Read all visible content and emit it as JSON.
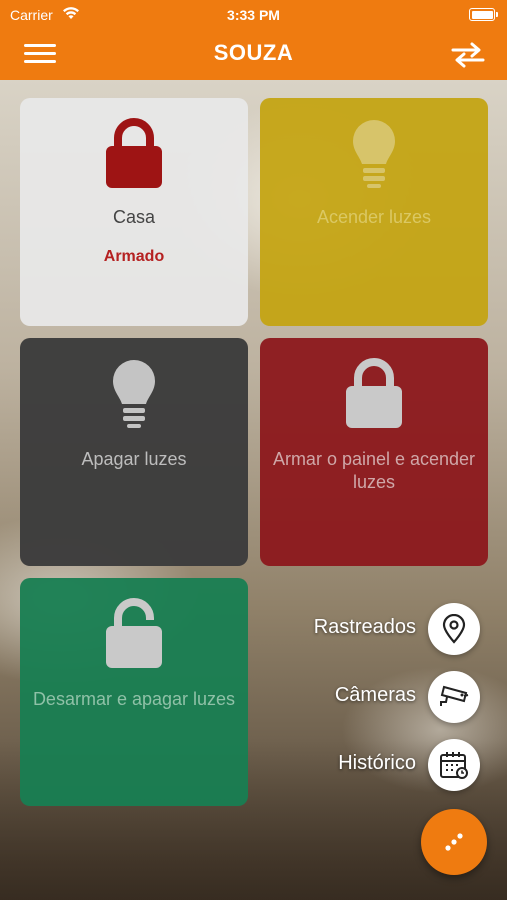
{
  "status_bar": {
    "carrier": "Carrier",
    "time": "3:33 PM"
  },
  "nav": {
    "title": "SOUZA"
  },
  "colors": {
    "accent": "#ef7b10",
    "armed": "#b52121"
  },
  "tiles": [
    {
      "label": "Casa",
      "status": "Armado",
      "icon": "lock-closed-icon"
    },
    {
      "label": "Acender luzes",
      "icon": "bulb-icon"
    },
    {
      "label": "Apagar luzes",
      "icon": "bulb-icon"
    },
    {
      "label": "Armar o painel e acender luzes",
      "icon": "lock-closed-icon"
    },
    {
      "label": "Desarmar e apagar luzes",
      "icon": "lock-open-icon"
    }
  ],
  "fab_menu": [
    {
      "label": "Rastreados",
      "icon": "location-pin-icon"
    },
    {
      "label": "Câmeras",
      "icon": "camera-icon"
    },
    {
      "label": "Histórico",
      "icon": "calendar-icon"
    }
  ]
}
